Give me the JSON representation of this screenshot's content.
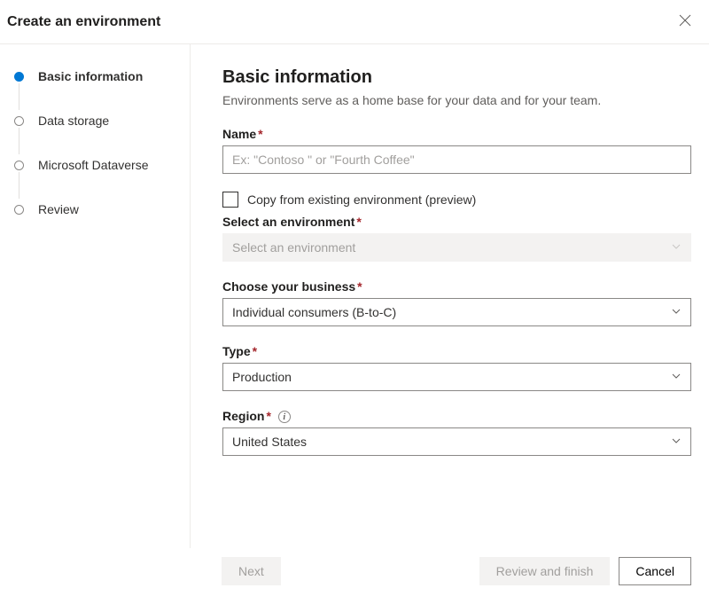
{
  "header": {
    "title": "Create an environment"
  },
  "steps": [
    {
      "label": "Basic information",
      "active": true
    },
    {
      "label": "Data storage",
      "active": false
    },
    {
      "label": "Microsoft Dataverse",
      "active": false
    },
    {
      "label": "Review",
      "active": false
    }
  ],
  "main": {
    "heading": "Basic information",
    "subtitle": "Environments serve as a home base for your data and for your team.",
    "name_label": "Name",
    "name_placeholder": "Ex: \"Contoso \" or \"Fourth Coffee\"",
    "name_value": "",
    "copy_label": "Copy from existing environment (preview)",
    "select_env_label": "Select an environment",
    "select_env_placeholder": "Select an environment",
    "business_label": "Choose your business",
    "business_value": "Individual consumers (B-to-C)",
    "type_label": "Type",
    "type_value": "Production",
    "region_label": "Region",
    "region_value": "United States"
  },
  "footer": {
    "next": "Next",
    "review": "Review and finish",
    "cancel": "Cancel"
  }
}
